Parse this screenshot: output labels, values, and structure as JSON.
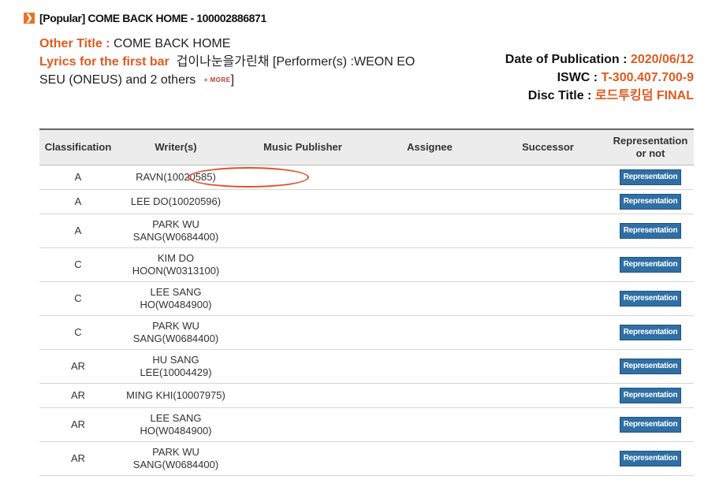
{
  "header": {
    "icon": "chevron-right-icon",
    "title": "[Popular] COME BACK HOME - 100002886871"
  },
  "info": {
    "other_title_label": "Other Title :",
    "other_title_value": "COME BACK HOME",
    "lyrics_label": "Lyrics for the first bar",
    "lyrics_value": "겁이나눈을가린채 [Performer(s) :WEON EO SEU (ONEUS) and 2 others",
    "more_label": "+ MORE",
    "lyrics_close": "]",
    "date_label": "Date of Publication :",
    "date_value": "2020/06/12",
    "iswc_label": "ISWC :",
    "iswc_value": "T-300.407.700-9",
    "disc_label": "Disc Title :",
    "disc_value": "로드투킹덤 FINAL"
  },
  "table": {
    "headers": [
      "Classification",
      "Writer(s)",
      "Music Publisher",
      "Assignee",
      "Successor",
      "Representation or not"
    ],
    "button_label": "Representation",
    "rows": [
      {
        "classification": "A",
        "writer_line1": "RAVN(10020585)",
        "writer_line2": ""
      },
      {
        "classification": "A",
        "writer_line1": "LEE DO(10020596)",
        "writer_line2": ""
      },
      {
        "classification": "A",
        "writer_line1": "PARK WU",
        "writer_line2": "SANG(W0684400)"
      },
      {
        "classification": "C",
        "writer_line1": "KIM DO",
        "writer_line2": "HOON(W0313100)"
      },
      {
        "classification": "C",
        "writer_line1": "LEE SANG",
        "writer_line2": "HO(W0484900)"
      },
      {
        "classification": "C",
        "writer_line1": "PARK WU",
        "writer_line2": "SANG(W0684400)"
      },
      {
        "classification": "AR",
        "writer_line1": "HU SANG",
        "writer_line2": "LEE(10004429)"
      },
      {
        "classification": "AR",
        "writer_line1": "MING KHI(10007975)",
        "writer_line2": ""
      },
      {
        "classification": "AR",
        "writer_line1": "LEE SANG",
        "writer_line2": "HO(W0484900)"
      },
      {
        "classification": "AR",
        "writer_line1": "PARK WU",
        "writer_line2": "SANG(W0684400)"
      }
    ]
  },
  "colors": {
    "accent": "#e05a1f",
    "button": "#2f6fa4",
    "highlight_circle": "#e0502a"
  }
}
